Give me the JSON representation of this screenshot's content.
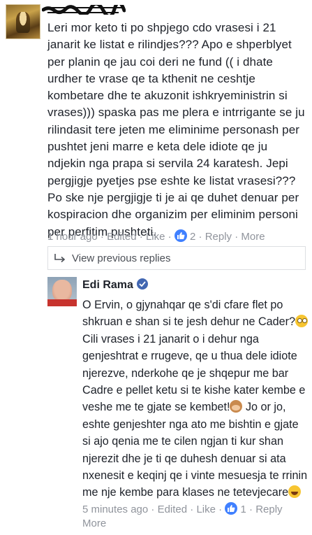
{
  "comment1": {
    "avatar": "user-avatar-warrior",
    "author_redacted": "",
    "text": "Leri mor keto ti po shpjego cdo vrasesi i 21 janarit ke listat e rilindjes??? Apo e shperblyet per planin qe jau coi deri ne fund (( i dhate urdher te vrase qe ta kthenit ne ceshtje kombetare dhe te akuzonit ishkryeministrin si vrases))) spaska pas me plera e intrrigante se ju rilindasit tere jeten me eliminime personash per pushtet jeni marre e keta dele idiote qe ju ndjekin nga prapa si servila 24 karatesh. Jepi pergjigje pyetjes pse eshte ke listat vrasesi??? Po ske nje pergjigje ti je ai qe duhet denuar per kospiracion dhe organizim per eliminim personi per perfitim pushteti.",
    "time": "1 hour ago",
    "edited": "Edited",
    "like": "Like",
    "like_count": "2",
    "reply": "Reply",
    "more": "More",
    "sep": "·"
  },
  "replies": {
    "view_previous": "View previous replies"
  },
  "comment2": {
    "author": "Edi Rama",
    "text_part1": "O Ervin, o gjynahqar qe s'di cfare flet po shkruan e shan si te jesh dehur ne Cader?",
    "text_part2": "Cili vrases i 21 janarit o i dehur nga genjeshtrat e rrugeve, qe u thua dele idiote njerezve, nderkohe qe je shqepur me bar Cadre e pellet ketu si te kishe kater kembe e veshe me te gjate se kembet!",
    "text_part3": " Jo or jo, eshte genjeshter nga ato me bishtin e gjate si ajo qenia me te cilen ngjan ti kur shan njerezit dhe je ti qe duhesh denuar si ata nxenesit e keqinj qe i vinte mesuesja te rrinin me nje kembe para klases ne tetevjecare",
    "time": "5 minutes ago",
    "edited": "Edited",
    "like": "Like",
    "like_count": "1",
    "reply": "Reply",
    "more": "More",
    "sep": "·"
  },
  "colors": {
    "meta_gray": "#90949c",
    "like_blue": "#4080ff",
    "verified_blue": "#4267b2"
  }
}
